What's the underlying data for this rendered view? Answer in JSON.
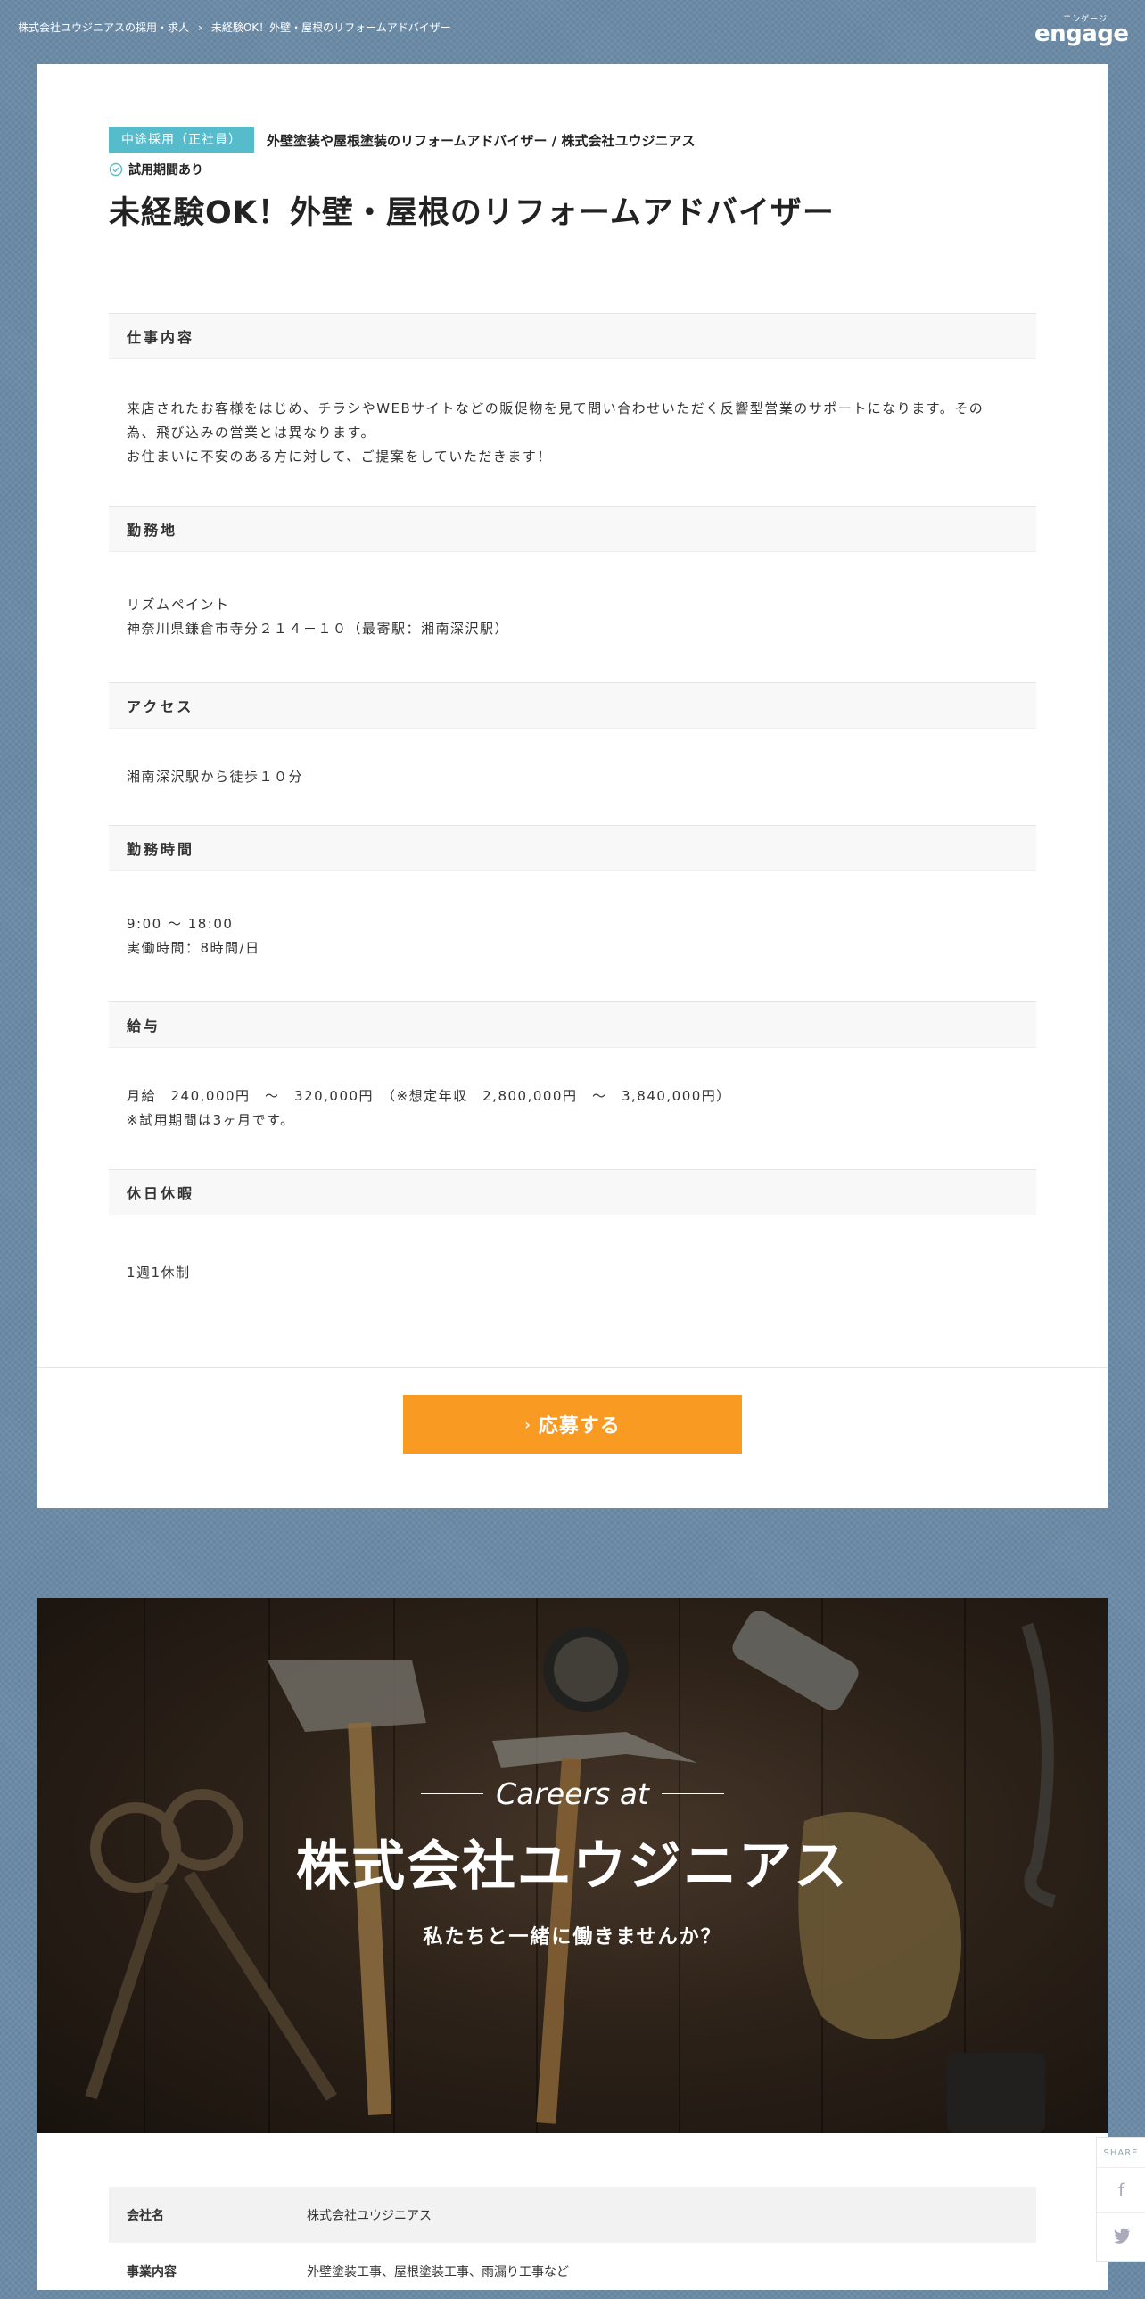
{
  "breadcrumb": {
    "items": [
      "株式会社ユウジニアスの採用・求人",
      "未経験OK！外壁・屋根のリフォームアドバイザー"
    ],
    "separator": "›"
  },
  "logo": {
    "kana": "エンゲージ",
    "word": "engage"
  },
  "job": {
    "employment_type": "中途採用（正社員）",
    "company_line": "外壁塗装や屋根塗装のリフォームアドバイザー / 株式会社ユウジニアス",
    "trial_label": "試用期間あり",
    "title": "未経験OK！外壁・屋根のリフォームアドバイザー"
  },
  "sections": [
    {
      "heading": "仕事内容",
      "lines": [
        "来店されたお客様をはじめ、チラシやWEBサイトなどの販促物を見て問い合わせいただく反響型営業のサポートになります。その",
        "為、飛び込みの営業とは異なります。",
        "お住まいに不安のある方に対して、ご提案をしていただきます！"
      ]
    },
    {
      "heading": "勤務地",
      "lines": [
        "リズムペイント",
        "神奈川県鎌倉市寺分２１４－１０（最寄駅：湘南深沢駅）"
      ]
    },
    {
      "heading": "アクセス",
      "lines": [
        "湘南深沢駅から徒歩１０分"
      ]
    },
    {
      "heading": "勤務時間",
      "lines": [
        "9:00 ～ 18:00",
        "実働時間：8時間/日"
      ]
    },
    {
      "heading": "給与",
      "lines": [
        "月給　240,000円　～　320,000円　（※想定年収　2,800,000円　～　3,840,000円）",
        "※試用期間は3ヶ月です。"
      ]
    },
    {
      "heading": "休日休暇",
      "lines": [
        "1週1休制"
      ]
    }
  ],
  "apply_button": {
    "label": "応募する",
    "icon": "chevron-right-icon",
    "color": "#f99b22"
  },
  "hero": {
    "careers_at": "Careers at",
    "company": "株式会社ユウジニアス",
    "subtitle": "私たちと一緒に働きませんか？"
  },
  "company_info": [
    {
      "key": "会社名",
      "value": "株式会社ユウジニアス"
    },
    {
      "key": "事業内容",
      "value": "外壁塗装工事、屋根塗装工事、雨漏り工事など"
    }
  ],
  "share": {
    "label": "SHARE",
    "facebook": "f",
    "twitter": "🐦"
  },
  "colors": {
    "background": "#6a8aa6",
    "badge": "#56bccc",
    "accent": "#f99b22"
  }
}
